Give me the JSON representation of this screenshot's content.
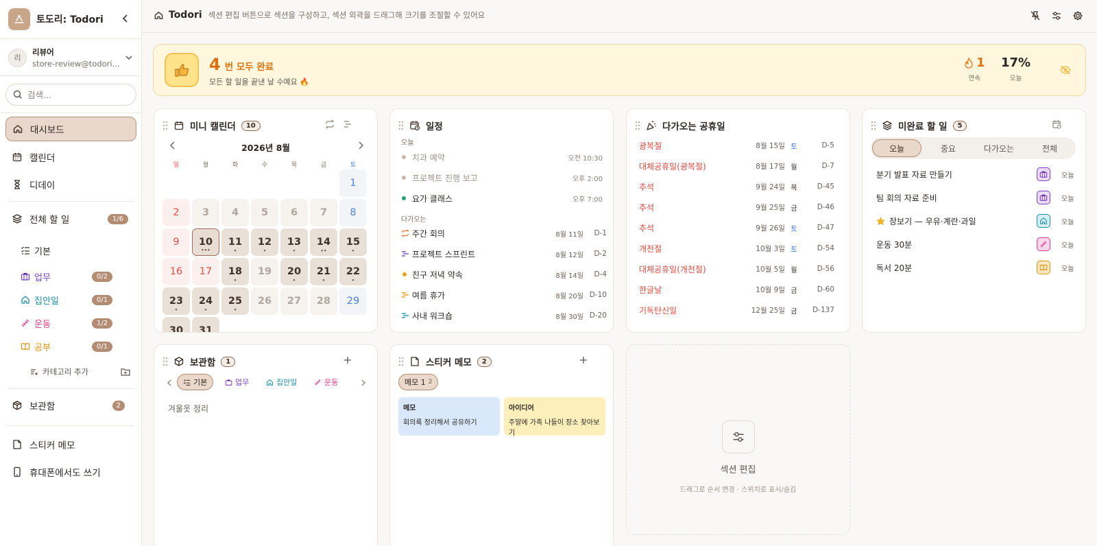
{
  "sidebar": {
    "app_name": "토도리: Todori",
    "user": {
      "avatar": "리",
      "name": "리뷰어",
      "email": "store-review@todori..."
    },
    "search_placeholder": "검색...",
    "nav": [
      {
        "label": "대시보드",
        "icon": "home-icon"
      },
      {
        "label": "캘린더",
        "icon": "calendar-icon"
      },
      {
        "label": "디데이",
        "icon": "hourglass-icon"
      }
    ],
    "all_todos": {
      "label": "전체 할 일",
      "badge": "1/6"
    },
    "default_category": "기본",
    "categories": [
      {
        "label": "업무",
        "badge": "0/2",
        "color": "#7b3fc4"
      },
      {
        "label": "집안일",
        "badge": "0/1",
        "color": "#1e8fa8"
      },
      {
        "label": "운동",
        "badge": "1/2",
        "color": "#d63d8c"
      },
      {
        "label": "공부",
        "badge": "0/1",
        "color": "#d99411"
      }
    ],
    "add_category": "카테고리 추가",
    "archive": {
      "label": "보관함",
      "badge": "2"
    },
    "sticky": "스티커 메모",
    "mobile": "휴대폰에서도 쓰기"
  },
  "topbar": {
    "title": "Todori",
    "description": "섹션 편집 버튼으로 섹션을 구성하고, 섹션 외곽을 드래그해 크기를 조절할 수 있어요"
  },
  "banner": {
    "count": "4",
    "title": "번 모두 완료",
    "subtitle": "모든 할 일을 끝낸 날 수예요 🔥",
    "streak_value": "1",
    "streak_label": "연속",
    "today_value": "17%",
    "today_label": "오늘"
  },
  "mini_calendar": {
    "title": "미니 캘린더",
    "count": "10",
    "month": "2026년 8월",
    "weekdays": [
      "일",
      "월",
      "화",
      "수",
      "목",
      "금",
      "토"
    ],
    "days": [
      {
        "d": "1",
        "s": "blue"
      },
      {
        "d": "2",
        "s": "red"
      },
      {
        "d": "3",
        "s": "past"
      },
      {
        "d": "4",
        "s": "past"
      },
      {
        "d": "5",
        "s": "past"
      },
      {
        "d": "6",
        "s": "past"
      },
      {
        "d": "7",
        "s": "past"
      },
      {
        "d": "8",
        "s": "blue"
      },
      {
        "d": "9",
        "s": "red"
      },
      {
        "d": "10",
        "s": "today",
        "dots": "•••"
      },
      {
        "d": "11",
        "s": "cur",
        "dots": "•"
      },
      {
        "d": "12",
        "s": "cur",
        "dots": "•"
      },
      {
        "d": "13",
        "s": "cur",
        "dots": "•"
      },
      {
        "d": "14",
        "s": "cur",
        "dots": "••"
      },
      {
        "d": "15",
        "s": "cur",
        "dots": "•"
      },
      {
        "d": "16",
        "s": "red"
      },
      {
        "d": "17",
        "s": "red"
      },
      {
        "d": "18",
        "s": "cur",
        "dots": "•"
      },
      {
        "d": "19",
        "s": "past"
      },
      {
        "d": "20",
        "s": "cur",
        "dots": "•"
      },
      {
        "d": "21",
        "s": "cur",
        "dots": "•"
      },
      {
        "d": "22",
        "s": "cur",
        "dots": "•"
      },
      {
        "d": "23",
        "s": "cur",
        "dots": "•"
      },
      {
        "d": "24",
        "s": "cur",
        "dots": "•"
      },
      {
        "d": "25",
        "s": "cur",
        "dots": "•"
      },
      {
        "d": "26",
        "s": "past"
      },
      {
        "d": "27",
        "s": "past"
      },
      {
        "d": "28",
        "s": "past"
      },
      {
        "d": "29",
        "s": "blue"
      },
      {
        "d": "30",
        "s": "cur"
      },
      {
        "d": "31",
        "s": "cur"
      }
    ]
  },
  "schedule": {
    "title": "일정",
    "today_label": "오늘",
    "upcoming_label": "다가오는",
    "today": [
      {
        "title": "치과 예약",
        "time": "오전 10:30",
        "bullet": "#c7b8ab",
        "done": true
      },
      {
        "title": "프로젝트 진행 보고",
        "time": "오후 2:00",
        "bullet": "#c7b8ab",
        "done": true
      },
      {
        "title": "요가 클래스",
        "time": "오후 7:00",
        "bullet": "#1fa37a",
        "done": false
      }
    ],
    "upcoming": [
      {
        "title": "주간 회의",
        "date": "8월 11일",
        "dday": "D-1",
        "icon": "repeat-icon",
        "color": "#e27d3a"
      },
      {
        "title": "프로젝트 스프린트",
        "date": "8월 12일",
        "dday": "D-2",
        "icon": "range-icon",
        "color": "#7b5cc8"
      },
      {
        "title": "친구 저녁 약속",
        "date": "8월 14일",
        "dday": "D-4",
        "icon": "dot-icon",
        "color": "#e8a11e"
      },
      {
        "title": "여름 휴가",
        "date": "8월 20일",
        "dday": "D-10",
        "icon": "range-icon",
        "color": "#e8a11e"
      },
      {
        "title": "사내 워크숍",
        "date": "8월 30일",
        "dday": "D-20",
        "icon": "range-icon",
        "color": "#2f9fb0"
      }
    ]
  },
  "holidays": {
    "title": "다가오는 공휴일",
    "items": [
      {
        "name": "광복절",
        "date": "8월 15일",
        "weekday": "토",
        "dday": "D-5"
      },
      {
        "name": "대체공휴일(광복절)",
        "date": "8월 17일",
        "weekday": "월",
        "dday": "D-7"
      },
      {
        "name": "추석",
        "date": "9월 24일",
        "weekday": "목",
        "dday": "D-45"
      },
      {
        "name": "추석",
        "date": "9월 25일",
        "weekday": "금",
        "dday": "D-46"
      },
      {
        "name": "추석",
        "date": "9월 26일",
        "weekday": "토",
        "dday": "D-47"
      },
      {
        "name": "개천절",
        "date": "10월 3일",
        "weekday": "토",
        "dday": "D-54"
      },
      {
        "name": "대체공휴일(개천절)",
        "date": "10월 5일",
        "weekday": "월",
        "dday": "D-56"
      },
      {
        "name": "한글날",
        "date": "10월 9일",
        "weekday": "금",
        "dday": "D-60"
      },
      {
        "name": "기독탄신일",
        "date": "12월 25일",
        "weekday": "금",
        "dday": "D-137"
      }
    ]
  },
  "incomplete": {
    "title": "미완료 할 일",
    "count": "5",
    "tabs": [
      "오늘",
      "중요",
      "다가오는",
      "전체"
    ],
    "items": [
      {
        "title": "분기 발표 자료 만들기",
        "icon": "briefcase-icon",
        "bg": "#eadcf7",
        "fg": "#7b3fc4",
        "label": "오늘"
      },
      {
        "title": "팀 회의 자료 준비",
        "icon": "briefcase-icon",
        "bg": "#eadcf7",
        "fg": "#7b3fc4",
        "label": "오늘"
      },
      {
        "title": "장보기 — 우유·계란·과일",
        "icon": "house-icon",
        "bg": "#d5eff3",
        "fg": "#1e8fa8",
        "label": "오늘",
        "star": true
      },
      {
        "title": "운동 30분",
        "icon": "dumbbell-icon",
        "bg": "#fbd9ea",
        "fg": "#d63d8c",
        "label": "오늘"
      },
      {
        "title": "독서 20분",
        "icon": "book-icon",
        "bg": "#fde8c2",
        "fg": "#d99411",
        "label": "오늘"
      }
    ]
  },
  "archive_card": {
    "title": "보관함",
    "count": "1",
    "chips": [
      {
        "label": "기본",
        "color": "#3a2e25"
      },
      {
        "label": "업무",
        "color": "#7b3fc4"
      },
      {
        "label": "집안일",
        "color": "#1e8fa8"
      },
      {
        "label": "운동",
        "color": "#d63d8c"
      }
    ],
    "items": [
      "겨울옷 정리"
    ]
  },
  "sticky_card": {
    "title": "스티커 메모",
    "count": "2",
    "chip_label": "메모 1",
    "chip_count": "2",
    "notes": [
      {
        "title": "메모",
        "body": "회의록 정리해서 공유하기",
        "color": "#d9e8fb"
      },
      {
        "title": "아이디어",
        "body": "주말에 가족 나들이 장소 찾아보기",
        "color": "#fdefbc"
      }
    ]
  },
  "section_edit": {
    "title": "섹션 편집",
    "hint": "드래그로 순서 변경 · 스위치로 표시/숨김"
  }
}
